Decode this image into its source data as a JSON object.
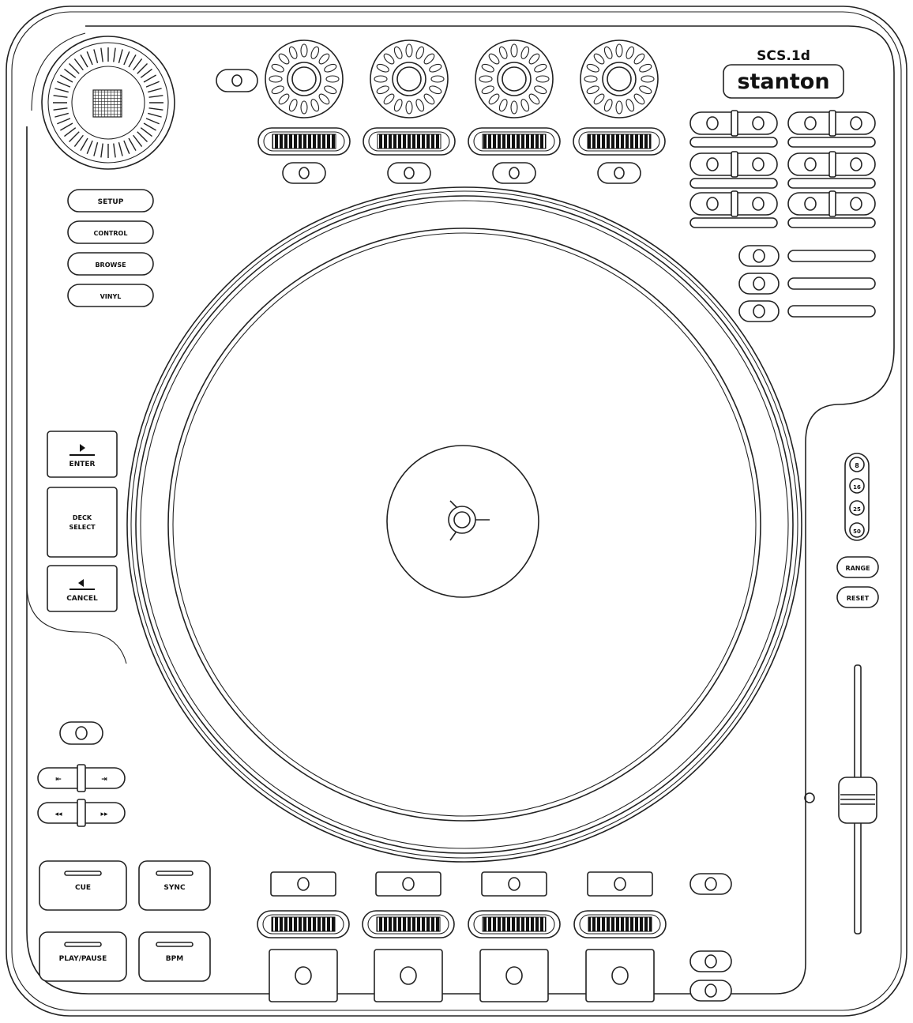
{
  "brand": {
    "model": "SCS.1d",
    "name": "stanton"
  },
  "mode_buttons": [
    "SETUP",
    "CONTROL",
    "BROWSE",
    "VINYL"
  ],
  "nav_buttons": {
    "enter": "ENTER",
    "deck_select_line1": "DECK",
    "deck_select_line2": "SELECT",
    "cancel": "CANCEL"
  },
  "transport": {
    "cue": "CUE",
    "sync": "SYNC",
    "play_pause": "PLAY/PAUSE",
    "bpm": "BPM"
  },
  "pitch": {
    "range_steps": [
      "8",
      "16",
      "25",
      "50"
    ],
    "range_label": "RANGE",
    "reset_label": "RESET"
  }
}
